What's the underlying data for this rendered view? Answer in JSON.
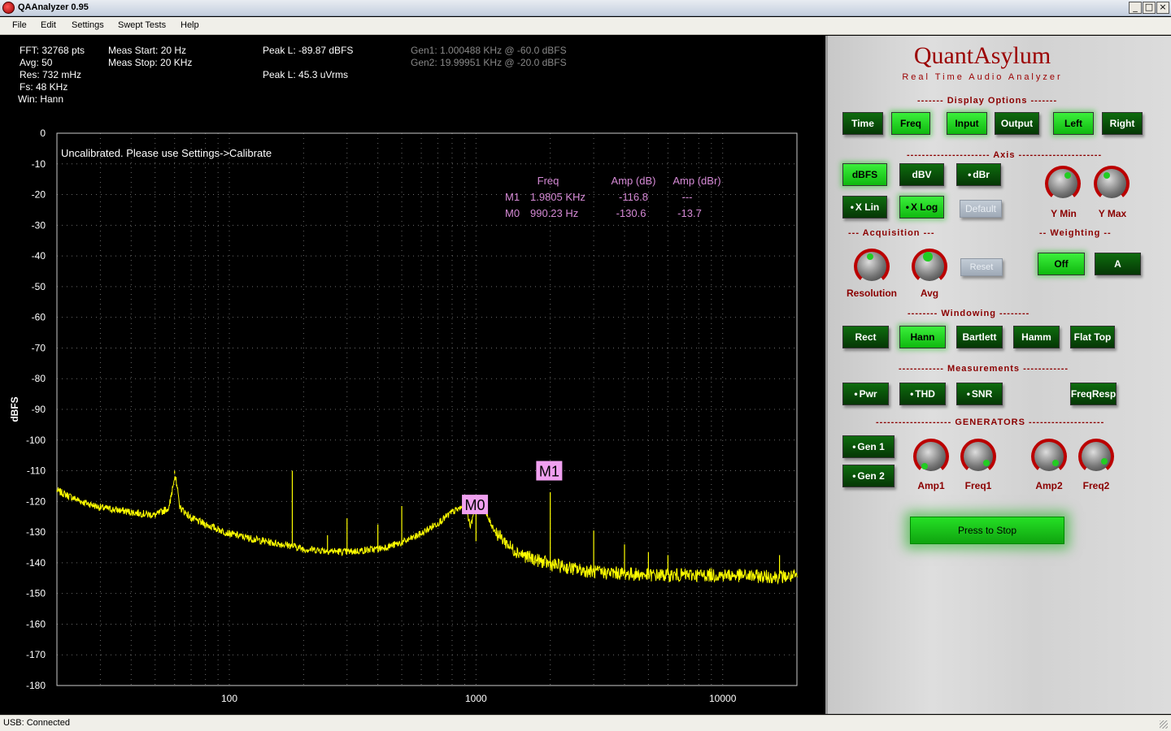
{
  "window": {
    "title": "QAAnalyzer 0.95",
    "minimize": "_",
    "maximize": "□",
    "close": "×"
  },
  "menu": [
    "File",
    "Edit",
    "Settings",
    "Swept Tests",
    "Help"
  ],
  "info": {
    "fft": "FFT: 32768 pts",
    "avg": "Avg: 50",
    "res": "Res: 732 mHz",
    "fs": "Fs: 48 KHz",
    "win": "Win: Hann",
    "meas_start": "Meas Start: 20 Hz",
    "meas_stop": "Meas Stop: 20 KHz",
    "peak_l_dbfs": "Peak L: -89.87 dBFS",
    "peak_l_uvrms": "Peak L: 45.3 uVrms",
    "gen1": "Gen1: 1.000488 KHz @ -60.0 dBFS",
    "gen2": "Gen2: 19.99951 KHz @ -20.0 dBFS"
  },
  "chart_data": {
    "type": "line",
    "ylabel": "dBFS",
    "x_scale": "log",
    "xlim": [
      20,
      20000
    ],
    "ylim": [
      -180,
      0
    ],
    "x_ticks": [
      "100",
      "1000",
      "10000"
    ],
    "y_ticks": [
      "0",
      "-10",
      "-20",
      "-30",
      "-40",
      "-50",
      "-60",
      "-70",
      "-80",
      "-90",
      "-100",
      "-110",
      "-120",
      "-130",
      "-140",
      "-150",
      "-160",
      "-170",
      "-180"
    ],
    "grid": true,
    "annotation": "Uncalibrated. Please use Settings->Calibrate",
    "series": [
      {
        "color": "#ffff00",
        "x": [
          20,
          25,
          30,
          40,
          50,
          57,
          60,
          63,
          70,
          80,
          100,
          120,
          150,
          180,
          200,
          300,
          400,
          500,
          600,
          700,
          800,
          900,
          950,
          1000,
          1050,
          1100,
          1200,
          1400,
          1600,
          2000,
          2500,
          3000,
          4000,
          5000,
          7000,
          10000,
          15000,
          20000
        ],
        "y": [
          -116.5,
          -120,
          -122,
          -123.5,
          -124.5,
          -122,
          -111,
          -122,
          -125.5,
          -127.5,
          -130.5,
          -132,
          -133.5,
          -134.5,
          -135.5,
          -136.5,
          -135.5,
          -133.5,
          -130.5,
          -127,
          -123.5,
          -121.5,
          -128,
          -119.5,
          -120,
          -124.5,
          -130,
          -135.5,
          -138,
          -140.5,
          -142,
          -143,
          -143.5,
          -144,
          -144,
          -144,
          -144.5,
          -144.5
        ],
        "spikes": [
          [
            60,
            -110
          ],
          [
            120,
            -131
          ],
          [
            180,
            -110
          ],
          [
            250,
            -131
          ],
          [
            300,
            -125.5
          ],
          [
            400,
            -127.5
          ],
          [
            500,
            -121.5
          ],
          [
            1000,
            -133
          ],
          [
            2000,
            -117
          ],
          [
            3000,
            -129.5
          ],
          [
            4000,
            -134
          ],
          [
            5000,
            -136.5
          ],
          [
            6000,
            -137.5
          ],
          [
            17000,
            -137.5
          ]
        ]
      }
    ],
    "markers": [
      {
        "label": "M1",
        "freq_hz": 1980.5,
        "amp_db": -110
      },
      {
        "label": "M0",
        "freq_hz": 990.23,
        "amp_db": -121
      }
    ],
    "table": {
      "headers": [
        "Freq",
        "Amp (dB)",
        "Amp (dBr)"
      ],
      "rows": [
        [
          "M1",
          "1.9805 KHz",
          "-116.8",
          "---"
        ],
        [
          "M0",
          "990.23 Hz",
          "-130.6",
          "-13.7"
        ]
      ]
    }
  },
  "panel": {
    "brand": "QuantAsylum",
    "subtitle": "Real Time Audio Analyzer",
    "display_options_label": "------- Display Options -------",
    "display_buttons": [
      {
        "label": "Time",
        "state": "off"
      },
      {
        "label": "Freq",
        "state": "on"
      },
      {
        "label": "Input",
        "state": "on"
      },
      {
        "label": "Output",
        "state": "off"
      },
      {
        "label": "Left",
        "state": "on"
      },
      {
        "label": "Right",
        "state": "off"
      }
    ],
    "axis_label": "---------------------- Axis ----------------------",
    "axis_buttons": [
      {
        "label": "dBFS",
        "state": "on"
      },
      {
        "label": "dBV",
        "state": "off"
      },
      {
        "label": "dBr",
        "state": "off"
      },
      {
        "label": "X Lin",
        "state": "off"
      },
      {
        "label": "X Log",
        "state": "on"
      },
      {
        "label": "Default",
        "state": "disabled"
      }
    ],
    "y_min_label": "Y Min",
    "y_max_label": "Y Max",
    "acquisition_label": "--- Acquisition ---",
    "weighting_label": "-- Weighting --",
    "resolution_label": "Resolution",
    "avg_label": "Avg",
    "acq_reset": "Reset",
    "weighting_buttons": [
      {
        "label": "Off",
        "state": "on"
      },
      {
        "label": "A",
        "state": "off"
      }
    ],
    "windowing_label": "-------- Windowing --------",
    "window_buttons": [
      {
        "label": "Rect",
        "state": "off"
      },
      {
        "label": "Hann",
        "state": "on"
      },
      {
        "label": "Bartlett",
        "state": "off"
      },
      {
        "label": "Hamm",
        "state": "off"
      },
      {
        "label": "Flat Top",
        "state": "off"
      }
    ],
    "measurements_label": "------------ Measurements ------------",
    "measure_buttons": [
      {
        "label": "Pwr",
        "state": "off"
      },
      {
        "label": "THD",
        "state": "off"
      },
      {
        "label": "SNR",
        "state": "off"
      },
      {
        "label": "FreqResp",
        "state": "off"
      }
    ],
    "generators_label": "-------------------- GENERATORS --------------------",
    "gen_buttons": [
      {
        "label": "Gen 1",
        "state": "off"
      },
      {
        "label": "Gen 2",
        "state": "off"
      }
    ],
    "amp1_label": "Amp1",
    "freq1_label": "Freq1",
    "amp2_label": "Amp2",
    "freq2_label": "Freq2",
    "stop_label": "Press to Stop"
  },
  "status": "USB: Connected"
}
